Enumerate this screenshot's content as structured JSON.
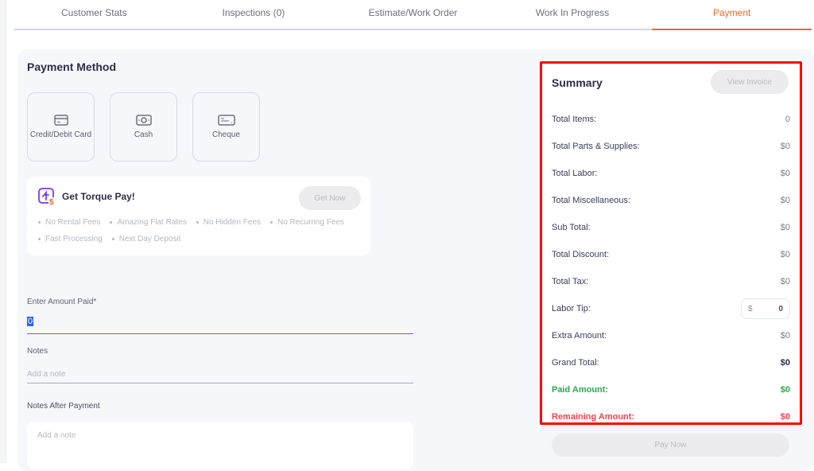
{
  "tabs": [
    {
      "label": "Customer Stats",
      "active": false
    },
    {
      "label": "Inspections (0)",
      "active": false
    },
    {
      "label": "Estimate/Work Order",
      "active": false
    },
    {
      "label": "Work In Progress",
      "active": false
    },
    {
      "label": "Payment",
      "active": true
    }
  ],
  "payment_method": {
    "title": "Payment Method",
    "options": [
      {
        "label": "Credit/Debit Card",
        "icon": "credit-card-icon"
      },
      {
        "label": "Cash",
        "icon": "cash-icon"
      },
      {
        "label": "Cheque",
        "icon": "cheque-icon"
      }
    ]
  },
  "torque_pay": {
    "title": "Get Torque Pay!",
    "icon": "torque-pay-logo-icon",
    "button_label": "Get Now",
    "features": [
      "No Rental Fees",
      "Amazing Flat Rates",
      "No Hidden Fees",
      "No Recurring Fees",
      "Fast Processing",
      "Next Day Deposit"
    ]
  },
  "form": {
    "amount_label": "Enter Amount Paid*",
    "amount_value": "0",
    "notes_label": "Notes",
    "notes_placeholder": "Add a note",
    "after_label": "Notes After Payment",
    "after_placeholder": "Add a note"
  },
  "summary": {
    "title": "Summary",
    "view_invoice_label": "View Invoice",
    "rows": [
      {
        "label": "Total Items:",
        "value": "0"
      },
      {
        "label": "Total Parts & Supplies:",
        "value": "$0"
      },
      {
        "label": "Total Labor:",
        "value": "$0"
      },
      {
        "label": "Total Miscellaneous:",
        "value": "$0"
      },
      {
        "label": "Sub Total:",
        "value": "$0"
      },
      {
        "label": "Total Discount:",
        "value": "$0"
      },
      {
        "label": "Total Tax:",
        "value": "$0"
      }
    ],
    "labor_tip": {
      "label": "Labor Tip:",
      "currency": "$",
      "value": "0"
    },
    "extra": {
      "label": "Extra Amount:",
      "value": "$0"
    },
    "grand": {
      "label": "Grand Total:",
      "value": "$0"
    },
    "paid": {
      "label": "Paid Amount:",
      "value": "$0"
    },
    "remaining": {
      "label": "Remaining Amount:",
      "value": "$0"
    }
  },
  "pay_now_label": "Pay Now",
  "colors": {
    "accent": "#f46a25",
    "paid": "#2fa84f",
    "remaining": "#f2454a",
    "highlight_border": "#ff0000"
  }
}
